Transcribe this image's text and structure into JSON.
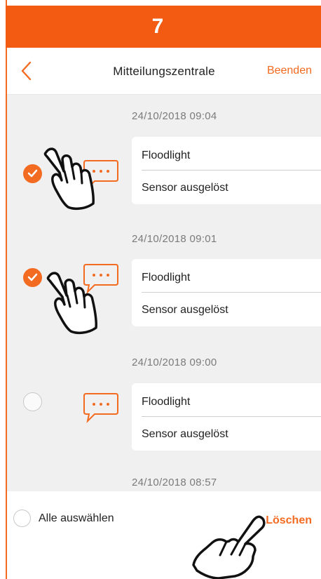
{
  "step": {
    "number": "7"
  },
  "header": {
    "title": "Mitteilungszentrale",
    "action": "Beenden",
    "back_icon": "chevron-left-icon"
  },
  "messages": [
    {
      "timestamp": "24/10/2018 09:04",
      "title": "Floodlight",
      "subtitle": "Sensor ausgelöst",
      "selected": true
    },
    {
      "timestamp": "24/10/2018 09:01",
      "title": "Floodlight",
      "subtitle": "Sensor ausgelöst",
      "selected": true
    },
    {
      "timestamp": "24/10/2018 09:00",
      "title": "Floodlight",
      "subtitle": "Sensor ausgelöst",
      "selected": false
    },
    {
      "timestamp": "24/10/2018 08:57"
    }
  ],
  "footer": {
    "select_all_label": "Alle auswählen",
    "delete_label": "Löschen"
  },
  "colors": {
    "accent": "#f36b21",
    "step_bar": "#f35a12",
    "list_background": "#f0f0f0"
  },
  "icons": [
    "chevron-left-icon",
    "checkmark-icon",
    "message-bubble-icon",
    "pointing-hand-icon"
  ]
}
